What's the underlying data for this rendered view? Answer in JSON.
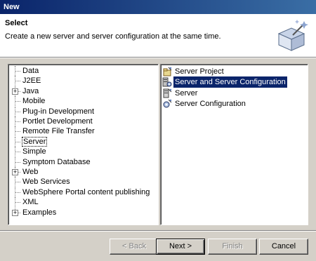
{
  "window": {
    "title": "New"
  },
  "banner": {
    "title": "Select",
    "description": "Create a new server and server configuration at the same time.",
    "icon": "new-wizard-icon"
  },
  "tree": {
    "items": [
      {
        "label": "Data",
        "expandable": false
      },
      {
        "label": "J2EE",
        "expandable": false
      },
      {
        "label": "Java",
        "expandable": true
      },
      {
        "label": "Mobile",
        "expandable": false
      },
      {
        "label": "Plug-in Development",
        "expandable": false
      },
      {
        "label": "Portlet Development",
        "expandable": false
      },
      {
        "label": "Remote File Transfer",
        "expandable": false
      },
      {
        "label": "Server",
        "expandable": false,
        "selected": true
      },
      {
        "label": "Simple",
        "expandable": false
      },
      {
        "label": "Symptom Database",
        "expandable": false
      },
      {
        "label": "Web",
        "expandable": true
      },
      {
        "label": "Web Services",
        "expandable": false
      },
      {
        "label": "WebSphere Portal content publishing",
        "expandable": false
      },
      {
        "label": "XML",
        "expandable": false
      },
      {
        "label": "Examples",
        "expandable": true
      }
    ],
    "expander_glyph": "+"
  },
  "wizards": {
    "items": [
      {
        "label": "Server Project",
        "icon": "server-project-icon"
      },
      {
        "label": "Server and Server Configuration",
        "icon": "server-and-config-icon",
        "selected": true
      },
      {
        "label": "Server",
        "icon": "server-icon"
      },
      {
        "label": "Server Configuration",
        "icon": "server-configuration-icon"
      }
    ]
  },
  "buttons": {
    "back": "< Back",
    "next": "Next >",
    "finish": "Finish",
    "cancel": "Cancel"
  },
  "colors": {
    "title_bar": "#0a246a",
    "selection": "#0a246a",
    "dialog_bg": "#d4d0c8"
  }
}
